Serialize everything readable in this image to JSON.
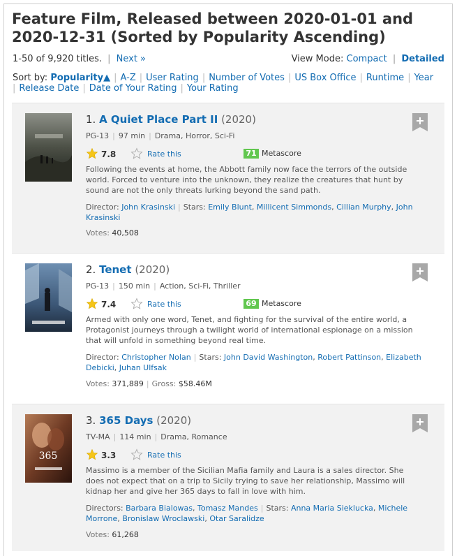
{
  "header": {
    "title": "Feature Film, Released between 2020-01-01 and 2020-12-31 (Sorted by Popularity Ascending)",
    "count": "1-50 of 9,920 titles.",
    "next": "Next »",
    "view_mode_label": "View Mode:",
    "view_compact": "Compact",
    "view_detailed": "Detailed"
  },
  "sort": {
    "label": "Sort by:",
    "active": "Popularity▲",
    "options": [
      "A-Z",
      "User Rating",
      "Number of Votes",
      "US Box Office",
      "Runtime",
      "Year",
      "Release Date",
      "Date of Your Rating",
      "Your Rating"
    ]
  },
  "labels": {
    "rate_this": "Rate this",
    "metascore": "Metascore",
    "votes": "Votes:",
    "gross": "Gross:"
  },
  "films": [
    {
      "index": "1.",
      "title": "A Quiet Place Part II",
      "year": "(2020)",
      "certificate": "PG-13",
      "runtime": "97 min",
      "genre": "Drama, Horror, Sci-Fi",
      "rating": "7.8",
      "metascore": "71",
      "description": "Following the events at home, the Abbott family now face the terrors of the outside world. Forced to venture into the unknown, they realize the creatures that hunt by sound are not the only threats lurking beyond the sand path.",
      "director_label": "Director:",
      "directors": [
        "John Krasinski"
      ],
      "stars_label": "Stars:",
      "stars": [
        "Emily Blunt",
        "Millicent Simmonds",
        "Cillian Murphy",
        "John Krasinski"
      ],
      "votes": "40,508",
      "gross": ""
    },
    {
      "index": "2.",
      "title": "Tenet",
      "year": "(2020)",
      "certificate": "PG-13",
      "runtime": "150 min",
      "genre": "Action, Sci-Fi, Thriller",
      "rating": "7.4",
      "metascore": "69",
      "description": "Armed with only one word, Tenet, and fighting for the survival of the entire world, a Protagonist journeys through a twilight world of international espionage on a mission that will unfold in something beyond real time.",
      "director_label": "Director:",
      "directors": [
        "Christopher Nolan"
      ],
      "stars_label": "Stars:",
      "stars": [
        "John David Washington",
        "Robert Pattinson",
        "Elizabeth Debicki",
        "Juhan Ulfsak"
      ],
      "votes": "371,889",
      "gross": "$58.46M"
    },
    {
      "index": "3.",
      "title": "365 Days",
      "year": "(2020)",
      "certificate": "TV-MA",
      "runtime": "114 min",
      "genre": "Drama, Romance",
      "rating": "3.3",
      "metascore": "",
      "description": "Massimo is a member of the Sicilian Mafia family and Laura is a sales director. She does not expect that on a trip to Sicily trying to save her relationship, Massimo will kidnap her and give her 365 days to fall in love with him.",
      "director_label": "Directors:",
      "directors": [
        "Barbara Bialowas",
        "Tomasz Mandes"
      ],
      "stars_label": "Stars:",
      "stars": [
        "Anna Maria Sieklucka",
        "Michele Morrone",
        "Bronislaw Wroclawski",
        "Otar Saralidze"
      ],
      "votes": "61,268",
      "gross": ""
    }
  ],
  "colors": {
    "link": "#136cb2",
    "metascore_green": "#61c74f",
    "star_gold": "#f5c518",
    "odd_row": "#f2f2f2"
  }
}
